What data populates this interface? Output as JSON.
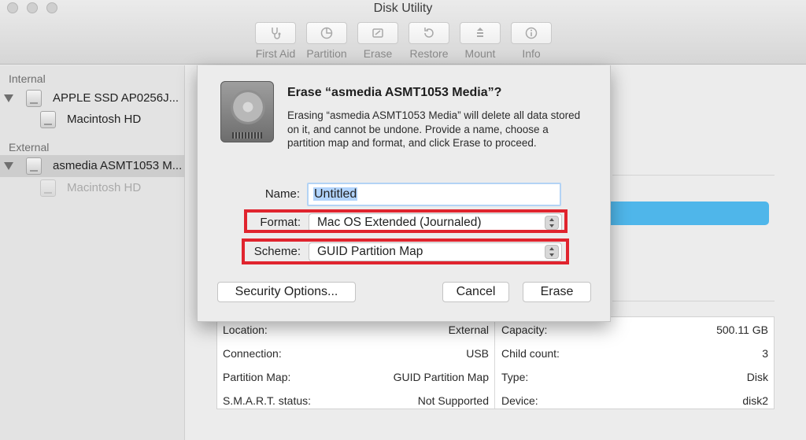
{
  "window": {
    "title": "Disk Utility"
  },
  "toolbar": {
    "items": [
      {
        "label": "First Aid",
        "icon": "stethoscope-icon"
      },
      {
        "label": "Partition",
        "icon": "pie-icon"
      },
      {
        "label": "Erase",
        "icon": "eraser-icon"
      },
      {
        "label": "Restore",
        "icon": "restore-arrow-icon"
      },
      {
        "label": "Mount",
        "icon": "mount-icon"
      },
      {
        "label": "Info",
        "icon": "info-icon"
      }
    ]
  },
  "sidebar": {
    "internal_title": "Internal",
    "external_title": "External",
    "items": [
      {
        "label": "APPLE SSD AP0256J..."
      },
      {
        "label": "Macintosh HD"
      },
      {
        "label": "asmedia ASMT1053 M..."
      },
      {
        "label": "Macintosh HD"
      }
    ]
  },
  "dialog": {
    "title": "Erase “asmedia ASMT1053 Media”?",
    "message": "Erasing “asmedia ASMT1053 Media” will delete all data stored on it, and cannot be undone. Provide a name, choose a partition map and format, and click Erase to proceed.",
    "name_label": "Name:",
    "name_value": "Untitled",
    "format_label": "Format:",
    "format_value": "Mac OS Extended (Journaled)",
    "scheme_label": "Scheme:",
    "scheme_value": "GUID Partition Map",
    "security_button": "Security Options...",
    "cancel_button": "Cancel",
    "erase_button": "Erase"
  },
  "info": {
    "left": [
      {
        "label": "Location:",
        "value": "External"
      },
      {
        "label": "Connection:",
        "value": "USB"
      },
      {
        "label": "Partition Map:",
        "value": "GUID Partition Map"
      },
      {
        "label": "S.M.A.R.T. status:",
        "value": "Not Supported"
      }
    ],
    "right": [
      {
        "label": "Capacity:",
        "value": "500.11 GB"
      },
      {
        "label": "Child count:",
        "value": "3"
      },
      {
        "label": "Type:",
        "value": "Disk"
      },
      {
        "label": "Device:",
        "value": "disk2"
      }
    ]
  },
  "colors": {
    "highlight": "#e0242e",
    "accent_bar": "#4fb6ea"
  }
}
